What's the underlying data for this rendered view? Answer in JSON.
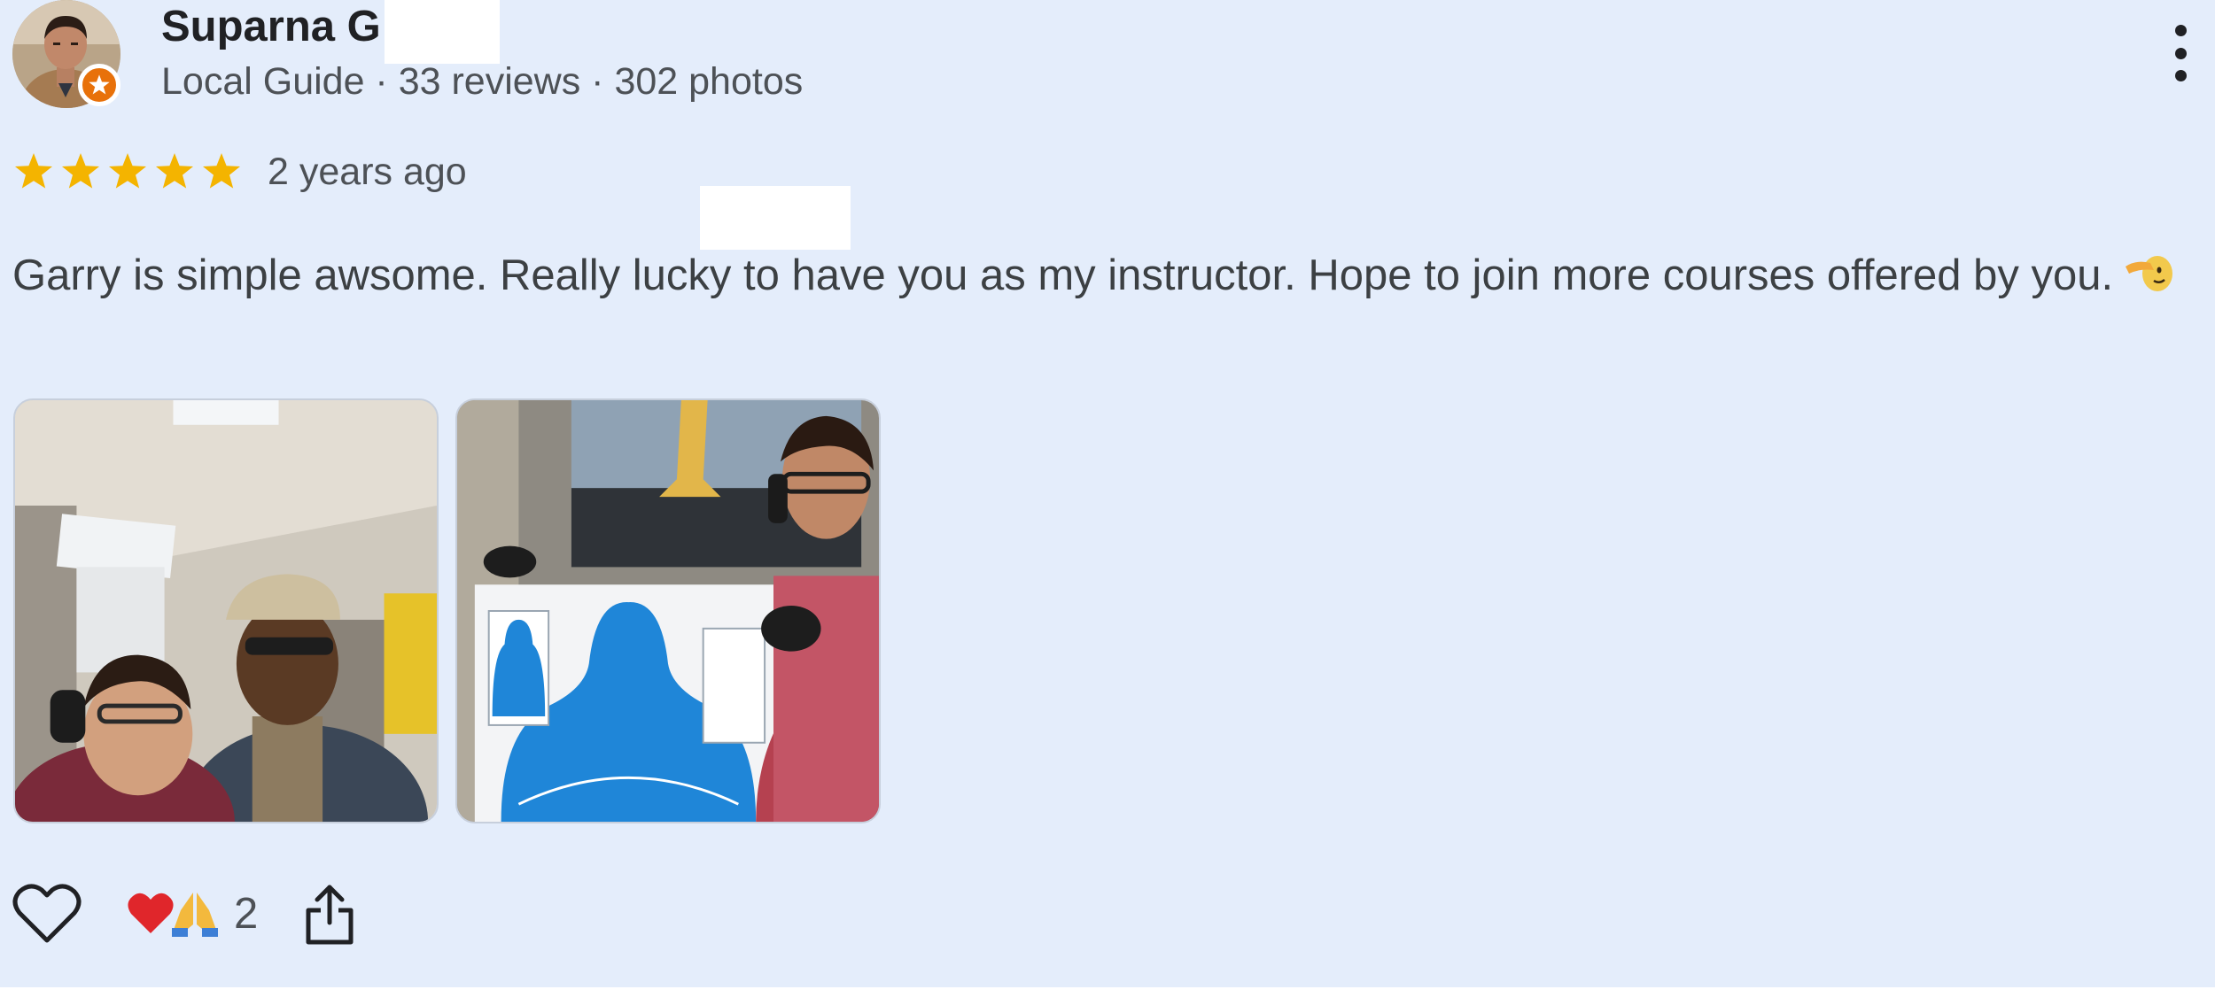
{
  "author": {
    "name": "Suparna G",
    "meta": "Local Guide · 33 reviews · 302 photos",
    "avatar_icon": "user-avatar-photo",
    "badge_icon": "local-guide-star-icon"
  },
  "review": {
    "rating": 5,
    "rating_max": 5,
    "date": "2 years ago",
    "text": "Garry is simple awsome. Really lucky to have you as my instructor. Hope to join more courses offered by you.",
    "emoji_icon": "saluting-face-emoji"
  },
  "photos": [
    {
      "icon": "photo-selfie-range"
    },
    {
      "icon": "photo-target-sheet"
    }
  ],
  "actions": {
    "like_icon": "heart-outline-icon",
    "reaction_icons": [
      "red-heart-emoji",
      "folded-hands-emoji"
    ],
    "reaction_count": "2",
    "share_icon": "share-icon",
    "menu_icon": "more-vertical-icon"
  },
  "colors": {
    "background": "#e4edfb",
    "star": "#f4b400",
    "badge": "#e8710a",
    "text_primary": "#202124",
    "text_secondary": "#4d5156"
  }
}
